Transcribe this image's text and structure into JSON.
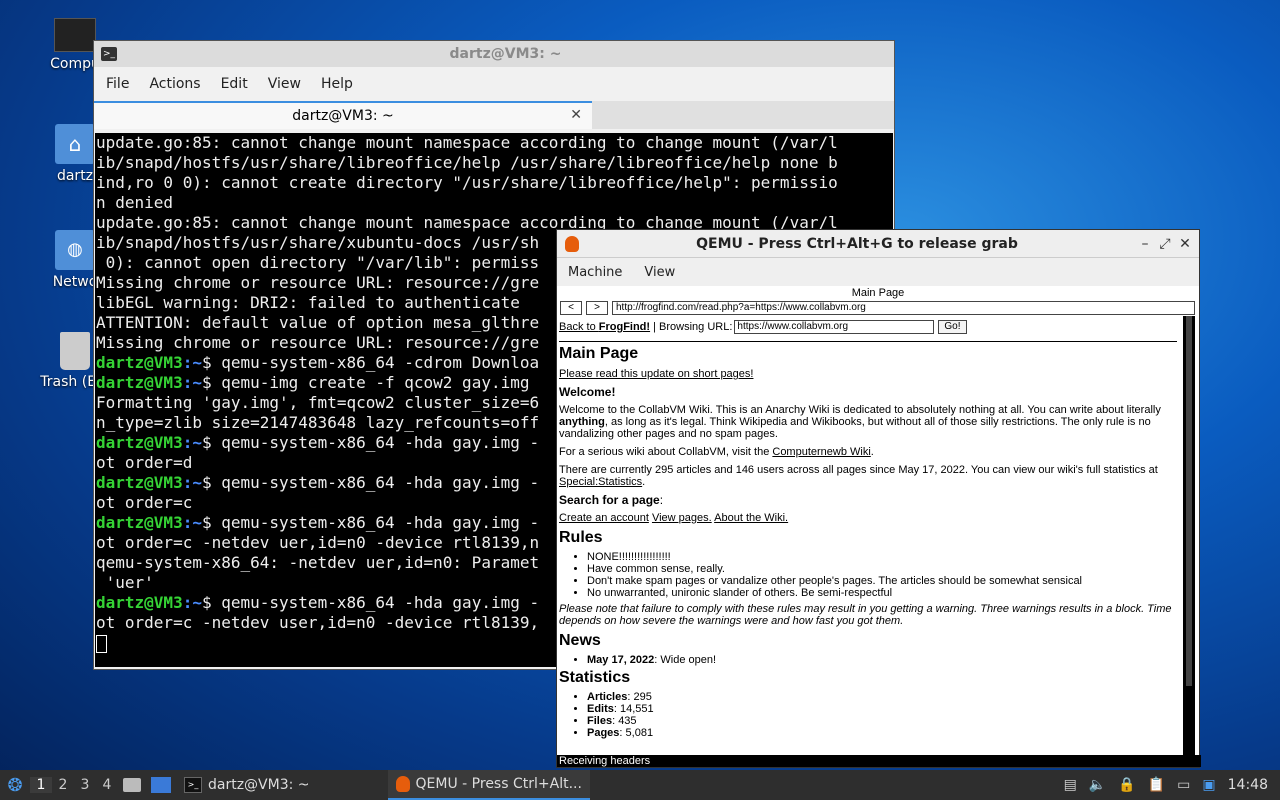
{
  "desktop": {
    "icons": [
      {
        "label": "Compu"
      },
      {
        "label": "dartz"
      },
      {
        "label": "Netwo"
      },
      {
        "label": "Trash (Em"
      }
    ]
  },
  "terminal": {
    "title": "dartz@VM3: ~",
    "menu": [
      "File",
      "Actions",
      "Edit",
      "View",
      "Help"
    ],
    "tab_label": "dartz@VM3: ~",
    "lines": [
      {
        "text": "update.go:85: cannot change mount namespace according to change mount (/var/l"
      },
      {
        "text": "ib/snapd/hostfs/usr/share/libreoffice/help /usr/share/libreoffice/help none b"
      },
      {
        "text": "ind,ro 0 0): cannot create directory \"/usr/share/libreoffice/help\": permissio"
      },
      {
        "text": "n denied"
      },
      {
        "text": "update.go:85: cannot change mount namespace according to change mount (/var/l"
      },
      {
        "text": "ib/snapd/hostfs/usr/share/xubuntu-docs /usr/sh"
      },
      {
        "text": " 0): cannot open directory \"/var/lib\": permiss"
      },
      {
        "text": "Missing chrome or resource URL: resource://gre"
      },
      {
        "text": "libEGL warning: DRI2: failed to authenticate"
      },
      {
        "text": "ATTENTION: default value of option mesa_glthre"
      },
      {
        "text": "Missing chrome or resource URL: resource://gre"
      },
      {
        "prompt": "dartz@VM3",
        "path": ":~",
        "cmd": "$ qemu-system-x86_64 -cdrom Downloa"
      },
      {
        "prompt": "dartz@VM3",
        "path": ":~",
        "cmd": "$ qemu-img create -f qcow2 gay.img"
      },
      {
        "text": "Formatting 'gay.img', fmt=qcow2 cluster_size=6"
      },
      {
        "text": "n_type=zlib size=2147483648 lazy_refcounts=off"
      },
      {
        "prompt": "dartz@VM3",
        "path": ":~",
        "cmd": "$ qemu-system-x86_64 -hda gay.img -"
      },
      {
        "text": "ot order=d"
      },
      {
        "prompt": "dartz@VM3",
        "path": ":~",
        "cmd": "$ qemu-system-x86_64 -hda gay.img -"
      },
      {
        "text": "ot order=c"
      },
      {
        "prompt": "dartz@VM3",
        "path": ":~",
        "cmd": "$ qemu-system-x86_64 -hda gay.img -"
      },
      {
        "text": "ot order=c -netdev uer,id=n0 -device rtl8139,n"
      },
      {
        "text": "qemu-system-x86_64: -netdev uer,id=n0: Paramet"
      },
      {
        "text": " 'uer'"
      },
      {
        "prompt": "dartz@VM3",
        "path": ":~",
        "cmd": "$ qemu-system-x86_64 -hda gay.img -"
      },
      {
        "text": "ot order=c -netdev user,id=n0 -device rtl8139,"
      }
    ]
  },
  "qemu": {
    "title": "QEMU - Press Ctrl+Alt+G to release grab",
    "menu": [
      "Machine",
      "View"
    ],
    "guest": {
      "page_title": "Main Page",
      "back_btn": "<",
      "fwd_btn": ">",
      "url": "http://frogfind.com/read.php?a=https://www.collabvm.org",
      "back_link_prefix": "Back to ",
      "back_link_bold": "FrogFind!",
      "browsing_label": " | Browsing URL:",
      "browsing_url": "https://www.collabvm.org",
      "go_btn": "Go!",
      "h_main": "Main Page",
      "update_link": "Please read this update on short pages!",
      "welcome_title": "Welcome!",
      "welcome_p1": "Welcome to the CollabVM Wiki. This is an Anarchy Wiki is dedicated to absolutely nothing at all. You can write about literally ",
      "welcome_bold": "anything",
      "welcome_p2": ", as long as it's legal. Think Wikipedia and Wikibooks, but without all of those silly restrictions. The only rule is no vandalizing other pages and no spam pages.",
      "serious_prefix": "For a serious wiki about CollabVM, visit the ",
      "serious_link": "Computernewb Wiki",
      "serious_suffix": ".",
      "stats_p1": "There are currently 295 articles and 146 users across all pages since May 17, 2022. You can view our wiki's full statistics at ",
      "stats_link": "Special:Statistics",
      "stats_suffix": ".",
      "search_title": "Search for a page",
      "search_colon": ":",
      "links": [
        "Create an account",
        "View pages.",
        "About the Wiki."
      ],
      "h_rules": "Rules",
      "rules": [
        "NONE!!!!!!!!!!!!!!!!!",
        "Have common sense, really.",
        "Don't make spam pages or vandalize other people's pages. The articles should be somewhat sensical",
        "No unwarranted, unironic slander of others. Be semi-respectful"
      ],
      "rules_note": "Please note that failure to comply with these rules may result in you getting a warning. Three warnings results in a block. Time depends on how severe the warnings were and how fast you got them.",
      "h_news": "News",
      "news_date": "May 17, 2022",
      "news_text": ": Wide open!",
      "h_stats": "Statistics",
      "stats": [
        {
          "k": "Articles",
          "v": ": 295"
        },
        {
          "k": "Edits",
          "v": ": 14,551"
        },
        {
          "k": "Files",
          "v": ": 435"
        },
        {
          "k": "Pages",
          "v": ": 5,081"
        }
      ],
      "status": "Receiving headers"
    }
  },
  "taskbar": {
    "workspaces": [
      "1",
      "2",
      "3",
      "4"
    ],
    "items": [
      {
        "label": "dartz@VM3: ~"
      },
      {
        "label": "QEMU - Press Ctrl+Alt..."
      }
    ],
    "clock": "14:48"
  }
}
